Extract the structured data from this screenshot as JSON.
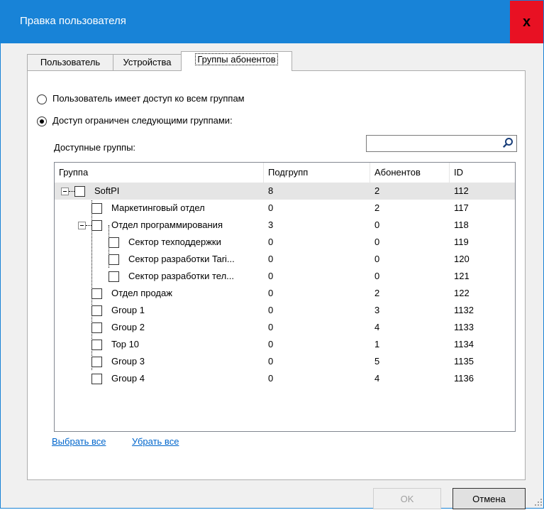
{
  "window": {
    "title": "Правка пользователя",
    "close_label": "x"
  },
  "tabs": [
    {
      "label": "Пользователь"
    },
    {
      "label": "Устройства"
    },
    {
      "label": "Группы абонентов"
    }
  ],
  "access": {
    "all_label": "Пользователь имеет доступ ко всем группам",
    "limited_label": "Доступ ограничен следующими группами:",
    "selected": "limited"
  },
  "available_label": "Доступные группы:",
  "search": {
    "value": "",
    "placeholder": ""
  },
  "table": {
    "columns": [
      "Группа",
      "Подгрупп",
      "Абонентов",
      "ID"
    ],
    "rows": [
      {
        "name": "SoftPI",
        "subgroups": "8",
        "subscribers": "2",
        "id": "112"
      },
      {
        "name": "Маркетинговый отдел",
        "subgroups": "0",
        "subscribers": "2",
        "id": "117"
      },
      {
        "name": "Отдел программирования",
        "subgroups": "3",
        "subscribers": "0",
        "id": "118"
      },
      {
        "name": "Сектор техподдержки",
        "subgroups": "0",
        "subscribers": "0",
        "id": "119"
      },
      {
        "name": "Сектор разработки Tari...",
        "subgroups": "0",
        "subscribers": "0",
        "id": "120"
      },
      {
        "name": "Сектор разработки тел...",
        "subgroups": "0",
        "subscribers": "0",
        "id": "121"
      },
      {
        "name": "Отдел продаж",
        "subgroups": "0",
        "subscribers": "2",
        "id": "122"
      },
      {
        "name": "Group 1",
        "subgroups": "0",
        "subscribers": "3",
        "id": "1132"
      },
      {
        "name": "Group 2",
        "subgroups": "0",
        "subscribers": "4",
        "id": "1133"
      },
      {
        "name": "Top 10",
        "subgroups": "0",
        "subscribers": "1",
        "id": "1134"
      },
      {
        "name": "Group 3",
        "subgroups": "0",
        "subscribers": "5",
        "id": "1135"
      },
      {
        "name": "Group 4",
        "subgroups": "0",
        "subscribers": "4",
        "id": "1136"
      }
    ]
  },
  "links": {
    "select_all": "Выбрать все",
    "deselect_all": "Убрать все"
  },
  "buttons": {
    "ok": "OK",
    "cancel": "Отмена"
  },
  "colors": {
    "titlebar": "#1883d7",
    "close": "#e81123",
    "link": "#0066cc"
  },
  "icons": [
    "close-icon",
    "search-icon",
    "collapse-icon",
    "resize-grip-icon"
  ]
}
